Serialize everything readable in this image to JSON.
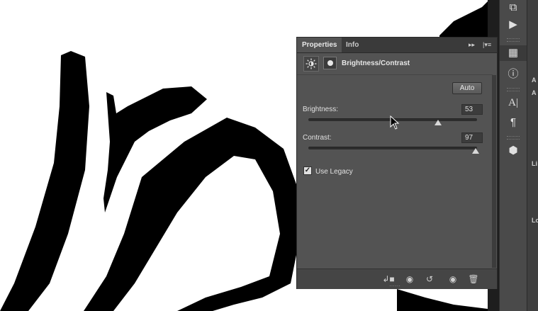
{
  "panel": {
    "tabs": [
      {
        "label": "Properties",
        "active": true
      },
      {
        "label": "Info",
        "active": false
      }
    ],
    "collapse_icon": "double-chevron-right-icon",
    "menu_icon": "panel-menu-icon",
    "adjustment_icon": "sun-adjustment-icon",
    "mask_icon": "layer-mask-icon",
    "title": "Brightness/Contrast",
    "auto_label": "Auto",
    "brightness": {
      "label": "Brightness:",
      "value": "53",
      "level": 0.77
    },
    "contrast": {
      "label": "Contrast:",
      "value": "97",
      "level": 0.99
    },
    "use_legacy": {
      "label": "Use Legacy",
      "checked": true
    },
    "footer_icons": [
      "clip-to-layer-icon",
      "view-previous-state-icon",
      "reset-icon",
      "visibility-eye-icon",
      "trash-icon"
    ]
  },
  "dock": {
    "icons": [
      "history-icon",
      "play-actions-icon",
      "properties-icon",
      "info-icon",
      "character-icon",
      "paragraph-icon",
      "3d-icon"
    ],
    "right_strip_letters": [
      "A",
      "A",
      "Li",
      "Lo"
    ]
  },
  "colors": {
    "panel_bg": "#535353",
    "tab_bg": "#3a3a3a",
    "dock_bg": "#4a4a4a",
    "canvas": "#ffffff",
    "ink": "#000000"
  }
}
